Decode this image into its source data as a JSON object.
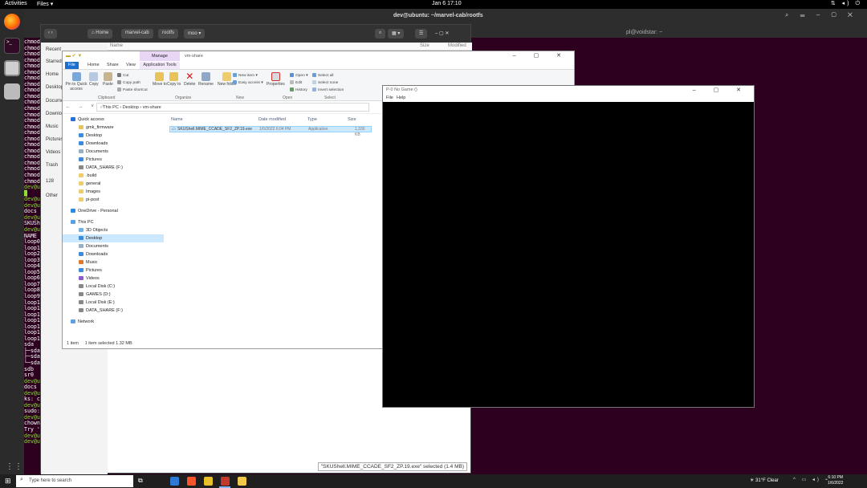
{
  "ubuntu_bar": {
    "activities": "Activities",
    "files_menu": "Files ▾",
    "clock": "Jan 6  17:10",
    "tray_icons": "network-icon volume-icon power-icon"
  },
  "terminal": {
    "title": "dev@ubuntu: ~/marvel-cab/rootfs",
    "subtitle": "pl@voidstar: ~",
    "lines": [
      "chmod",
      "chmod",
      "chmod",
      "chmod",
      "chmod",
      "chmod",
      "chmod",
      "chmod",
      "chmod",
      "chmod",
      "chmod",
      "chmod",
      "chmod",
      "chmod",
      "chmod",
      "chmod",
      "chmod",
      "chmod",
      "chmod",
      "chmod",
      "chmod",
      "chmod",
      "chmod",
      "chmod",
      "dev@u",
      "█",
      "dev@u",
      "dev@u",
      "docs",
      "dev@u",
      "SKUSh",
      "dev@u",
      "NAME",
      "loop0",
      "loop1",
      "loop2",
      "loop3",
      "loop4",
      "loop5",
      "loop6",
      "loop7",
      "loop8",
      "loop9",
      "loop1",
      "loop1",
      "loop1",
      "loop1",
      "loop1",
      "loop1",
      "loop1",
      "sda",
      "├─sda",
      "├─sda",
      "└─sda",
      "sdb",
      "sr0",
      "dev@u",
      "docs",
      "dev@u",
      "ks: c",
      "dev@u",
      "sudo:",
      "dev@u",
      "chown",
      "Try '",
      "dev@u",
      "dev@u"
    ]
  },
  "nautilus": {
    "nav_home": "Home",
    "crumbs": [
      "marvel-cab",
      "rootfs",
      "moo"
    ],
    "sidebar": [
      "Recent",
      "Starred",
      "Home",
      "Desktop",
      "Documents",
      "Downloads",
      "Music",
      "Pictures",
      "Videos",
      "Trash",
      "128",
      "Other"
    ],
    "col_name": "Name",
    "col_size": "Size",
    "col_modified": "Modified",
    "status": "\"SKUShell.MIME_CCADE_SF2_ZP.19.exe\" selected  (1.4 MB)"
  },
  "explorer": {
    "title_tab_manage": "Manage",
    "window_title": "vm-share",
    "tabs": {
      "file": "File",
      "home": "Home",
      "share": "Share",
      "view": "View",
      "apptools": "Application Tools"
    },
    "ribbon": {
      "pin": "Pin to Quick access",
      "copy": "Copy",
      "paste": "Paste",
      "cut": "Cut",
      "copy_path": "Copy path",
      "paste_shortcut": "Paste shortcut",
      "move_to": "Move to",
      "copy_to": "Copy to",
      "delete": "Delete",
      "rename": "Rename",
      "new_folder": "New folder",
      "new_item": "New item ▾",
      "easy_access": "Easy access ▾",
      "properties": "Properties",
      "open": "Open ▾",
      "edit": "Edit",
      "history": "History",
      "select_all": "Select all",
      "select_none": "Select none",
      "invert_selection": "Invert selection",
      "group_clipboard": "Clipboard",
      "group_organize": "Organize",
      "group_new": "New",
      "group_open": "Open",
      "group_select": "Select"
    },
    "path": "›  This PC  ›  Desktop  ›  vm-share",
    "sidebar": [
      "Quick access",
      "gmk_firmware",
      "Desktop",
      "Downloads",
      "Documents",
      "Pictures",
      "DATA_SHARE (F:)",
      ".build",
      "general",
      "Images",
      "pi-post",
      "OneDrive - Personal",
      "This PC",
      "3D Objects",
      "Desktop",
      "Documents",
      "Downloads",
      "Music",
      "Pictures",
      "Videos",
      "Local Disk (C:)",
      "GAMES (D:)",
      "Local Disk (E:)",
      "DATA_SHARE (F:)",
      "Network"
    ],
    "columns": {
      "name": "Name",
      "date": "Date modified",
      "type": "Type",
      "size": "Size"
    },
    "file": {
      "name": "SKUShell.MIME_CCADE_SF2_ZP.19.exe",
      "date": "1/6/2022 6:04 PM",
      "type": "Application",
      "size": "1,330 KB"
    },
    "status_items": "1 item",
    "status_selected": "1 item selected  1.32 MB"
  },
  "game_window": {
    "title": "P-0 No Game ()",
    "menu_file": "File",
    "menu_help": "Help"
  },
  "taskbar": {
    "search_placeholder": "Type here to search",
    "weather": "31°F  Clear",
    "time": "6:10 PM",
    "date": "1/6/2022"
  }
}
